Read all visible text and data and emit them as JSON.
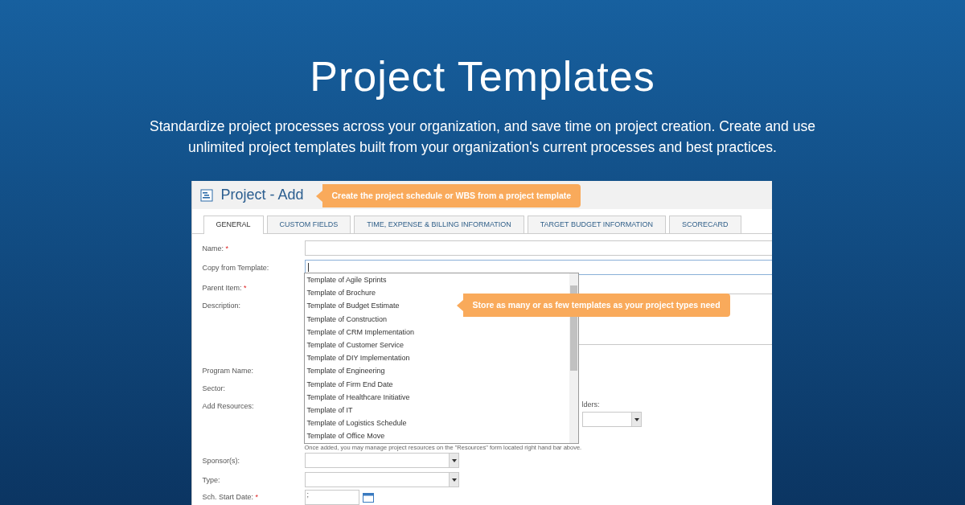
{
  "hero": {
    "title": "Project Templates",
    "subtitle": "Standardize project processes across your organization, and save time on project creation. Create and use unlimited project templates built from your organization's current processes and best practices."
  },
  "app": {
    "page_title": "Project - Add",
    "callouts": [
      {
        "text": "Create the project schedule or WBS from a project template"
      },
      {
        "text": "Store as many or as few templates as your project types need"
      }
    ],
    "tabs": [
      {
        "label": "GENERAL",
        "selected": true
      },
      {
        "label": "CUSTOM FIELDS",
        "selected": false
      },
      {
        "label": "TIME, EXPENSE & BILLING INFORMATION",
        "selected": false
      },
      {
        "label": "TARGET BUDGET INFORMATION",
        "selected": false
      },
      {
        "label": "SCORECARD",
        "selected": false
      }
    ],
    "fields": [
      {
        "label": "Name:",
        "required_mark": "*",
        "kind": "text"
      },
      {
        "label": "Copy from Template:",
        "kind": "focused"
      },
      {
        "label": "Parent Item:",
        "required_mark": "*",
        "kind": "hidden"
      },
      {
        "label": "Description:",
        "kind": "textarea"
      },
      {
        "label": "Program Name:",
        "kind": "hidden"
      },
      {
        "label": "Sector:",
        "kind": "hidden"
      },
      {
        "label": "Add Resources:",
        "kind": "resources",
        "side_label": "lders:",
        "note": "Once added, you may manage project resources on the \"Resources\" form located right hand bar above."
      },
      {
        "label": "Sponsor(s):",
        "kind": "select"
      },
      {
        "label": "Type:",
        "kind": "select"
      },
      {
        "label": "Sch. Start Date:",
        "required_mark": "*",
        "kind": "date",
        "value": ";"
      }
    ],
    "template_list": {
      "items": [
        "Template of Agile Sprints",
        "Template of Brochure",
        "Template of Budget Estimate",
        "Template of Construction",
        "Template of CRM Implementation",
        "Template of Customer Service",
        "Template of DIY Implementation",
        "Template of Engineering",
        "Template of Firm End Date",
        "Template of Healthcare Initiative",
        "Template of IT",
        "Template of Logistics Schedule",
        "Template of Office Move"
      ]
    }
  }
}
